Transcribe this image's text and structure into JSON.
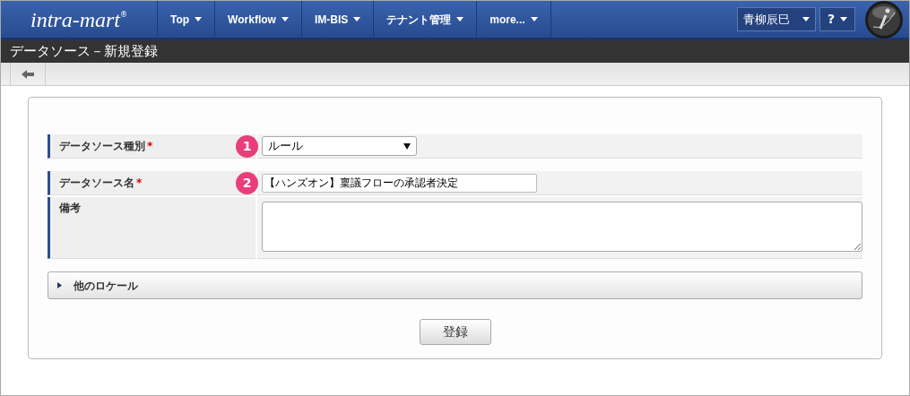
{
  "header": {
    "logo": "intra-mart",
    "logo_mark": "®",
    "nav": [
      {
        "label": "Top"
      },
      {
        "label": "Workflow"
      },
      {
        "label": "IM-BIS"
      },
      {
        "label": "テナント管理"
      },
      {
        "label": "more..."
      }
    ],
    "user": "青柳辰巳",
    "help": "?"
  },
  "page_title": "データソース－新規登録",
  "form": {
    "rows": [
      {
        "kind": "select",
        "label": "データソース種別",
        "required_mark": "*",
        "badge": "1",
        "value": "ルール"
      },
      {
        "kind": "text",
        "label": "データソース名",
        "required_mark": "*",
        "badge": "2",
        "value": "【ハンズオン】稟議フローの承認者決定"
      },
      {
        "kind": "textarea",
        "label": "備考"
      }
    ],
    "locale_section": {
      "label": "他のロケール",
      "expanded": false
    },
    "submit": "登録"
  }
}
